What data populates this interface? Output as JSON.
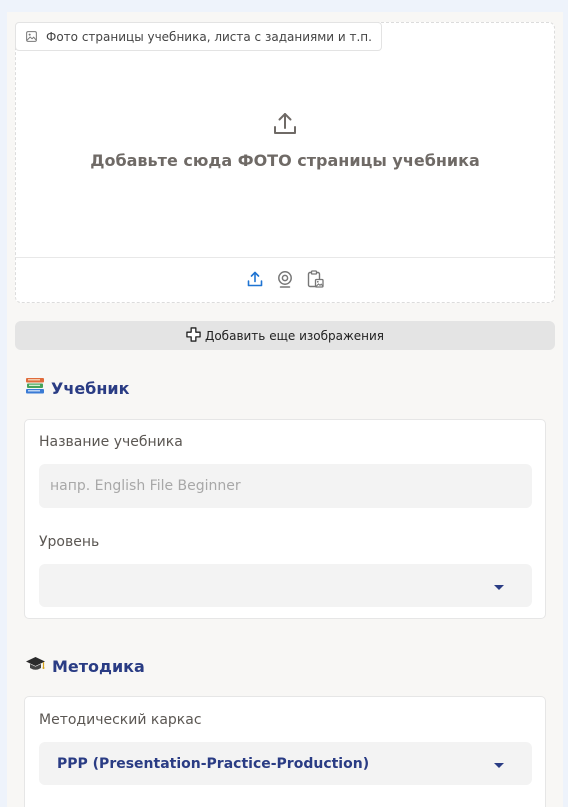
{
  "upload": {
    "tab_label": "Фото страницы учебника, листа с заданиями и т.п.",
    "prompt": "Добавьте сюда ФОТО страницы учебника",
    "tools": [
      "upload-icon",
      "webcam-icon",
      "paste-clipboard-icon"
    ]
  },
  "add_more_label": "Добавить еще изображения",
  "textbook": {
    "title": "Учебник",
    "name_label": "Название учебника",
    "name_placeholder": "напр. English File Beginner",
    "name_value": "",
    "level_label": "Уровень",
    "level_value": ""
  },
  "methodology": {
    "title": "Методика",
    "framework_label": "Методический каркас",
    "framework_value": "PPP (Presentation-Practice-Production)"
  },
  "colors": {
    "accent": "#2a3c84",
    "upload_icon": "#1f74d2",
    "page_bg": "#eef3fb",
    "panel_bg": "#f8f7f5"
  }
}
